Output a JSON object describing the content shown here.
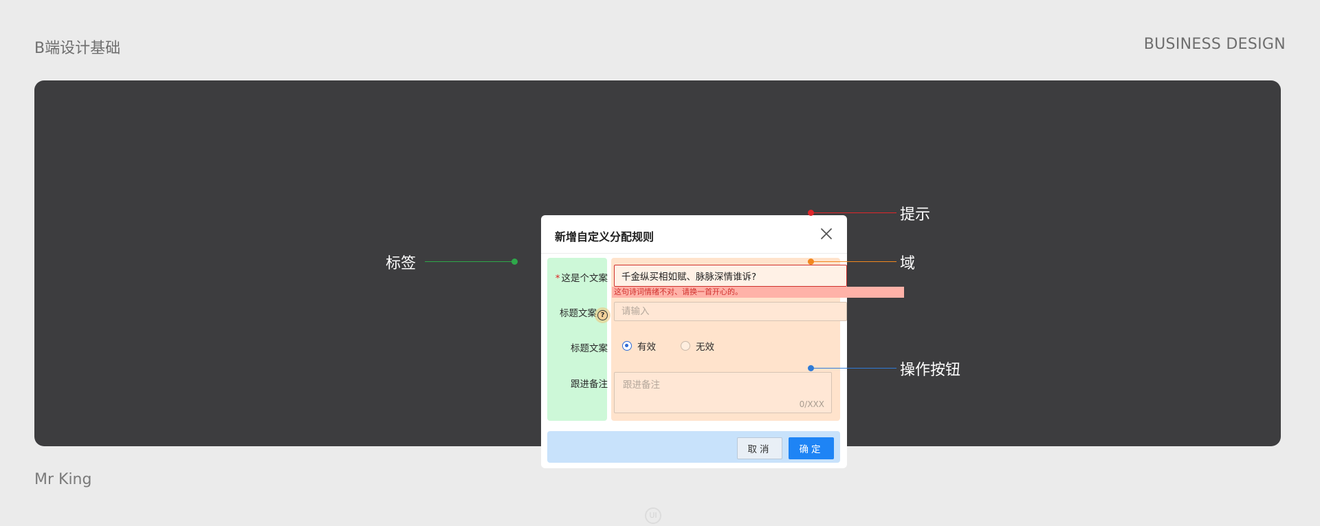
{
  "header": {
    "title": "B端设计基础",
    "tag": "BUSINESS DESIGN"
  },
  "footer": {
    "author": "Mr King",
    "watermark": "UI"
  },
  "modal": {
    "title": "新增自定义分配规则",
    "fields": [
      {
        "label": "这是个文案",
        "required": true,
        "type": "text",
        "value": "千金纵买相如赋、脉脉深情谁诉?",
        "error": "这句诗词情绪不对、请换一首开心的。"
      },
      {
        "label": "标题文案",
        "has_help": true,
        "help_glyph": "?",
        "type": "text",
        "value": "",
        "placeholder": "请输入"
      },
      {
        "label": "标题文案",
        "type": "radio",
        "options": [
          "有效",
          "无效"
        ],
        "selected": "有效"
      },
      {
        "label": "跟进备注",
        "type": "textarea",
        "placeholder": "跟进备注",
        "counter": "0/XXX"
      }
    ],
    "cancel_label": "取消",
    "ok_label": "确定",
    "required_mark": "*"
  },
  "annotations": {
    "hint": "提示",
    "label": "标签",
    "field": "域",
    "actions": "操作按钮"
  },
  "colors": {
    "stage_bg": "#3d3d3f",
    "label_area": "#cdf8d8",
    "field_area": "#ffe3cc",
    "action_area": "#c8e2fb",
    "error": "#d0312d",
    "primary": "#1e84f5",
    "annotation_hint": "#e0262a",
    "annotation_label": "#2ea84a",
    "annotation_field": "#f2871e",
    "annotation_actions": "#2f7bd6"
  }
}
